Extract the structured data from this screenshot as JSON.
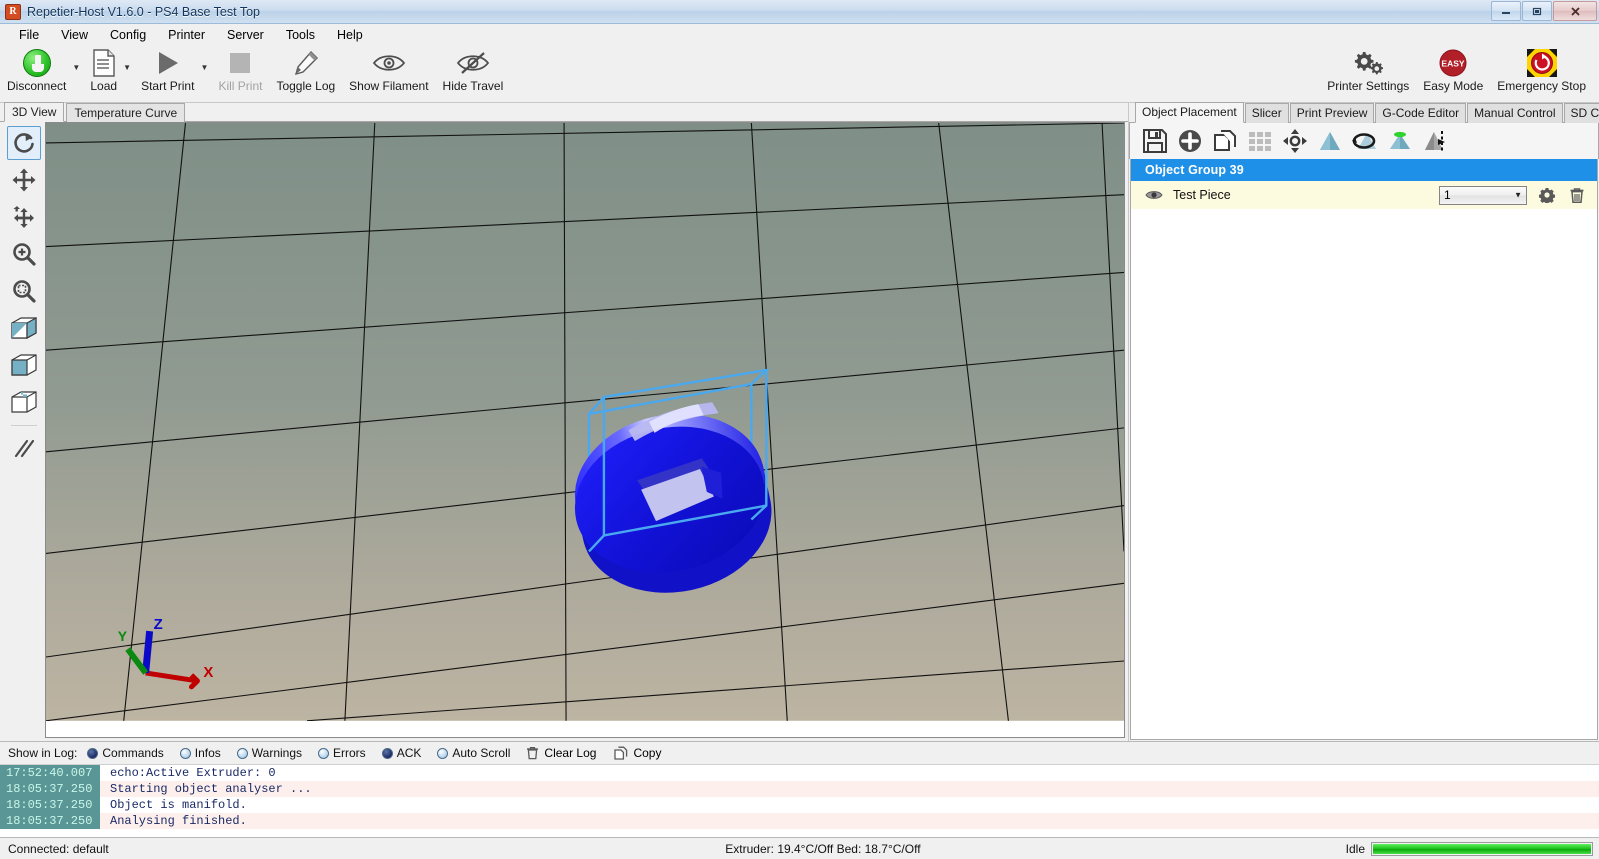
{
  "window": {
    "title": "Repetier-Host V1.6.0 - PS4 Base Test Top",
    "app_icon": "R",
    "minimize": "minimize-icon",
    "restore": "restore-icon",
    "close": "close-icon"
  },
  "menu": {
    "items": [
      {
        "label": "File"
      },
      {
        "label": "View"
      },
      {
        "label": "Config"
      },
      {
        "label": "Printer"
      },
      {
        "label": "Server"
      },
      {
        "label": "Tools"
      },
      {
        "label": "Help"
      }
    ]
  },
  "toolbar": {
    "left_buttons": [
      {
        "label": "Disconnect",
        "icon": "plug-icon",
        "dropdown": true,
        "disabled": false
      },
      {
        "label": "Load",
        "icon": "document-icon",
        "dropdown": true,
        "disabled": false
      },
      {
        "label": "Start Print",
        "icon": "play-icon",
        "dropdown": true,
        "disabled": false
      },
      {
        "label": "Kill Print",
        "icon": "stop-square-icon",
        "dropdown": false,
        "disabled": true
      },
      {
        "label": "Toggle Log",
        "icon": "pencil-icon",
        "dropdown": false,
        "disabled": false
      },
      {
        "label": "Show Filament",
        "icon": "eye-icon",
        "dropdown": false,
        "disabled": false
      },
      {
        "label": "Hide Travel",
        "icon": "eye-slash-icon",
        "dropdown": false,
        "disabled": false
      }
    ],
    "right_buttons": [
      {
        "label": "Printer Settings",
        "icon": "gears-icon"
      },
      {
        "label": "Easy Mode",
        "icon": "easy-badge-icon",
        "badge_text": "EASY"
      },
      {
        "label": "Emergency Stop",
        "icon": "emergency-stop-icon"
      }
    ]
  },
  "view": {
    "tabs": [
      {
        "label": "3D View",
        "active": true
      },
      {
        "label": "Temperature Curve",
        "active": false
      }
    ],
    "sidebar_tools": [
      {
        "name": "rotate-view-tool",
        "active": true
      },
      {
        "name": "move-view-tool",
        "active": false
      },
      {
        "name": "move-object-tool",
        "active": false
      },
      {
        "name": "zoom-tool",
        "active": false
      },
      {
        "name": "zoom-fit-tool",
        "active": false
      },
      {
        "name": "view-mode-split-tool",
        "active": false
      },
      {
        "name": "view-mode-solid-tool",
        "active": false
      },
      {
        "name": "view-mode-wireframe-tool",
        "active": false
      },
      {
        "name": "parallel-lines-tool",
        "active": false
      }
    ],
    "axis_labels": {
      "x": "X",
      "y": "Y",
      "z": "Z"
    },
    "bed_color_top": "#8b9a92",
    "bed_color_bottom": "#b5ae9e",
    "object_color": "#1414e0",
    "bounding_box_color": "#4aa8ef"
  },
  "panel": {
    "tabs": [
      {
        "label": "Object Placement",
        "active": true
      },
      {
        "label": "Slicer",
        "active": false
      },
      {
        "label": "Print Preview",
        "active": false
      },
      {
        "label": "G-Code Editor",
        "active": false
      },
      {
        "label": "Manual Control",
        "active": false
      },
      {
        "label": "SD Card",
        "active": false
      }
    ],
    "object_tools": [
      {
        "name": "save-object-button"
      },
      {
        "name": "add-object-button"
      },
      {
        "name": "copy-object-button"
      },
      {
        "name": "autoposition-grid-button"
      },
      {
        "name": "center-object-button"
      },
      {
        "name": "scale-object-button"
      },
      {
        "name": "rotate-object-button"
      },
      {
        "name": "lay-flat-button"
      },
      {
        "name": "mirror-object-button"
      }
    ],
    "group_label": "Object Group 39",
    "group_color": "#1e90e8",
    "objects": [
      {
        "name": "Test Piece",
        "visible_icon": "eye-icon",
        "count": "1",
        "settings_icon": "gear-icon",
        "delete_icon": "trash-icon"
      }
    ]
  },
  "log": {
    "show_label": "Show in Log:",
    "filters": [
      {
        "label": "Commands",
        "on": true
      },
      {
        "label": "Infos",
        "on": false
      },
      {
        "label": "Warnings",
        "on": false
      },
      {
        "label": "Errors",
        "on": false
      },
      {
        "label": "ACK",
        "on": true
      },
      {
        "label": "Auto Scroll",
        "on": false
      }
    ],
    "actions": [
      {
        "label": "Clear Log",
        "icon": "trash-icon"
      },
      {
        "label": "Copy",
        "icon": "copy-icon"
      }
    ],
    "lines": [
      {
        "time": "17:52:40.007",
        "message": "echo:Active Extruder: 0"
      },
      {
        "time": "18:05:37.250",
        "message": "Starting object analyser ..."
      },
      {
        "time": "18:05:37.250",
        "message": "Object is manifold."
      },
      {
        "time": "18:05:37.250",
        "message": "Analysing finished."
      }
    ]
  },
  "statusbar": {
    "connection": "Connected: default",
    "temperatures": "Extruder: 19.4°C/Off Bed: 18.7°C/Off",
    "state": "Idle",
    "progress_percent": 100
  }
}
